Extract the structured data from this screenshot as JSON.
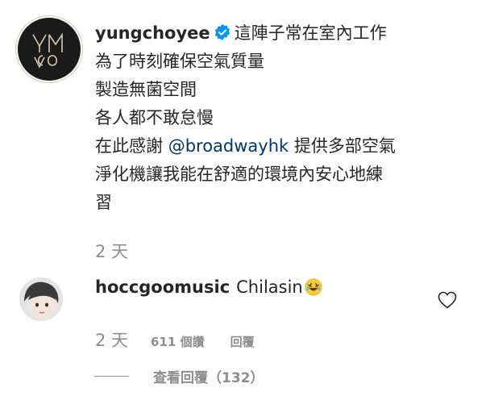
{
  "post": {
    "username": "yungchoyee",
    "caption_lines": [
      "這陣子常在室內工作",
      "為了時刻確保空氣質量",
      "製造無菌空間",
      "各人都不敢怠慢",
      "在此感謝 @broadwayhk 提供多部空氣",
      "淨化機讓我能在舒適的環境內安心地練",
      "習"
    ],
    "line5_prefix": "在此感謝 ",
    "mention": "@broadwayhk",
    "line5_suffix": " 提供多部空氣",
    "time": "2 天",
    "avatar_monogram": "YMCYO"
  },
  "reply": {
    "username": "hoccgoomusic",
    "text": "Chilasin",
    "emoji": "rolling-on-floor-laughing",
    "time": "2 天",
    "likes": "611 個讚",
    "reply_label": "回覆",
    "view_replies": "查看回覆（132）"
  },
  "colors": {
    "text": "#262626",
    "secondary": "#8e8e8e",
    "verified": "#0095f6",
    "mention": "#00376b"
  },
  "icons": [
    "verified-badge-icon",
    "heart-icon",
    "laughing-emoji-icon"
  ]
}
